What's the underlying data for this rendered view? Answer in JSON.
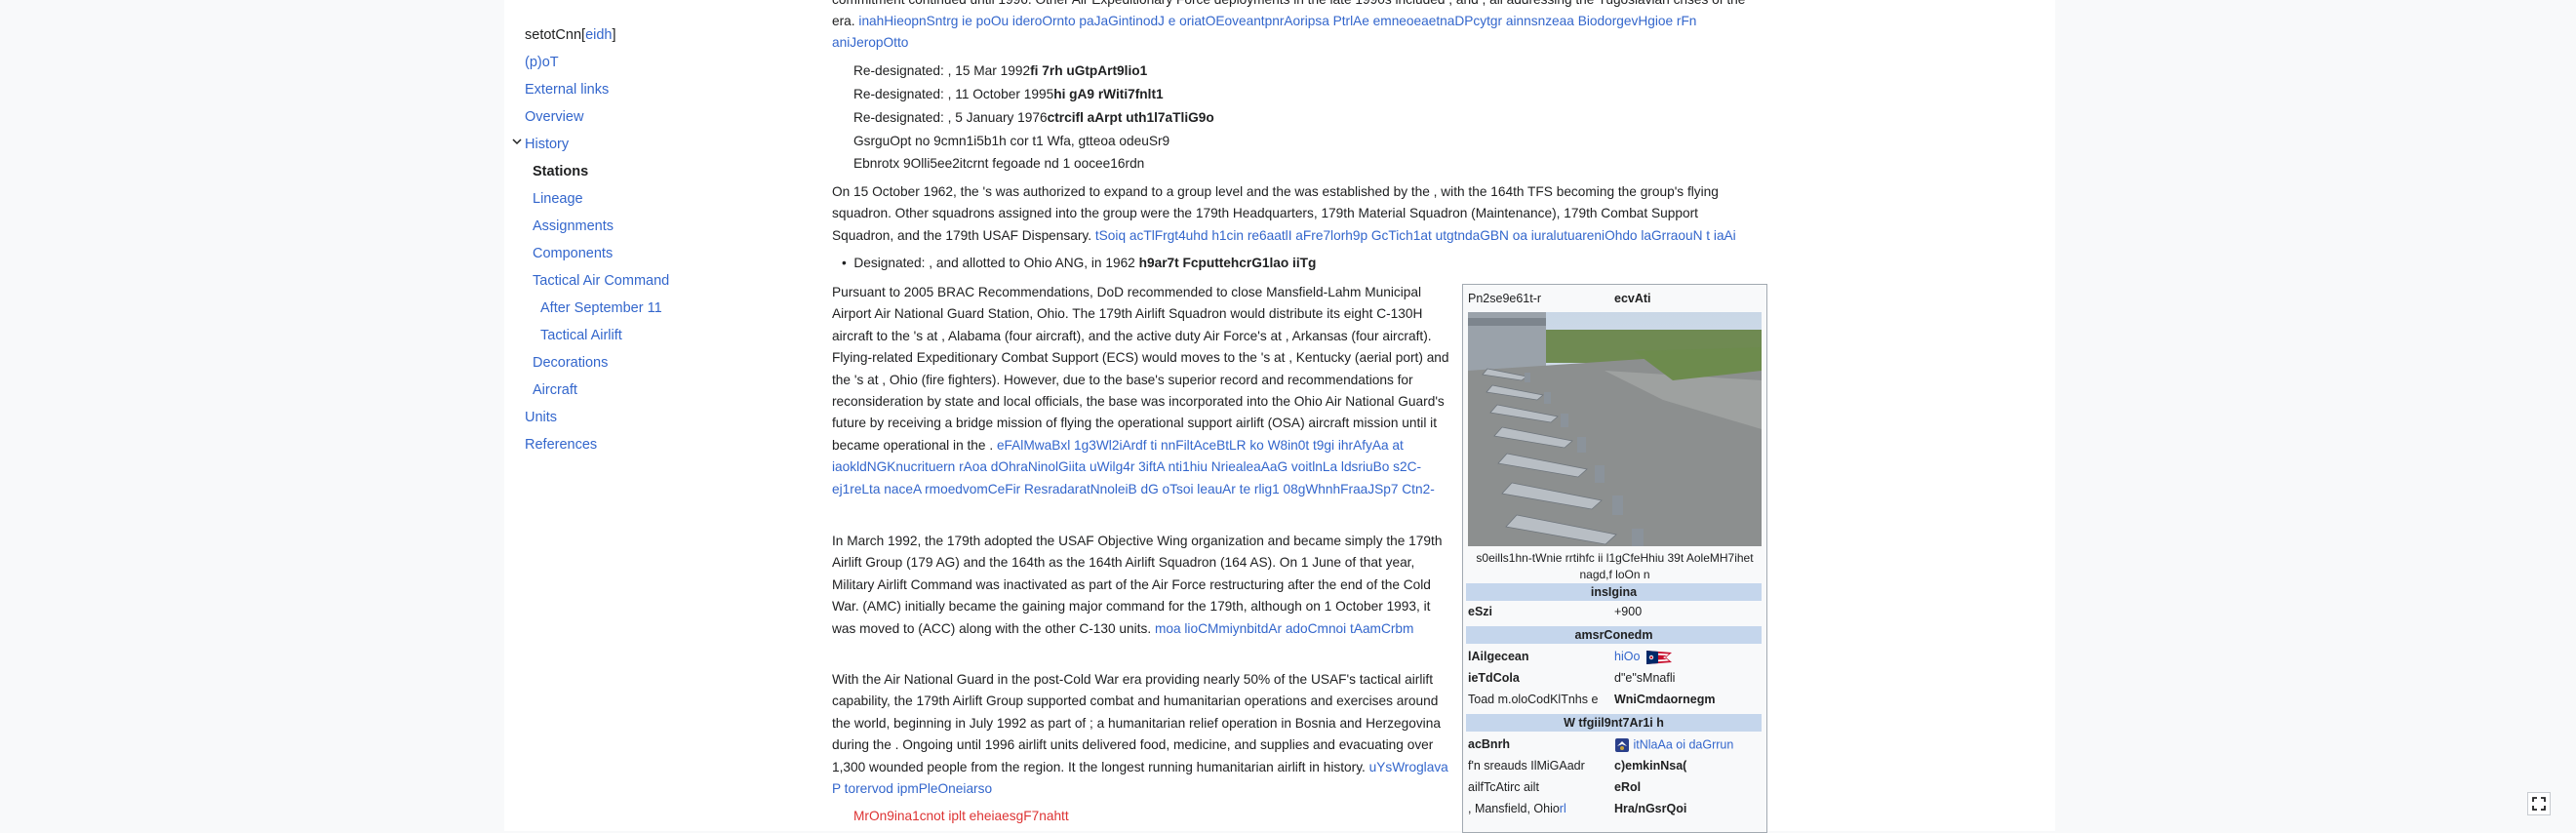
{
  "toc": {
    "contents_label": "setotCnn",
    "hide_label": "eidh",
    "items": [
      {
        "label": "(p)oT"
      },
      {
        "label": "External links"
      },
      {
        "label": "Overview"
      },
      {
        "label": "History"
      },
      {
        "label": "Stations"
      },
      {
        "label": "Lineage"
      },
      {
        "label": "Assignments"
      },
      {
        "label": "Components"
      },
      {
        "label": "Tactical Air Command"
      },
      {
        "label": "After September 11"
      },
      {
        "label": "Tactical Airlift"
      },
      {
        "label": "Decorations"
      },
      {
        "label": "Aircraft"
      },
      {
        "label": "Units"
      },
      {
        "label": "References"
      }
    ]
  },
  "article": {
    "top_text_1": "commitment continued until 1996. Other Air Expeditionary Force deployments in the late 1990s included , and , all addressing the Yugoslavian crises of the",
    "top_text_2_a": "era.",
    "top_text_2_link": "inahHieopnSntrg ie poOu ideroOrnto paJaGintinodJ e oriatOEoveantpnrAoripsa PtrlAe emneoeaetnaDPcytgr ainnsnzeaa BiodorgevHgioe rFn",
    "top_text_3_link": "aniJeropOtto",
    "redesig_1": {
      "text": "Re-designated: , 15 Mar 1992",
      "bold": "fi 7rh uGtpArt9lio1"
    },
    "redesig_2": {
      "text": "Re-designated: , 11 October 1995",
      "bold": "hi gA9 rWiti7fnlt1"
    },
    "redesig_3": {
      "text": "Re-designated: , 5 January 1976",
      "bold": "ctrcifl aArpt uth1l7aTliG9o"
    },
    "line_4": "GsrguOpt no 9cmn1i5b1h cor t1 Wfa, gtteoa odeuSr9",
    "line_5": "Ebnrotx 9Olli5ee2itcrnt fegoade nd 1 oocee16rdn",
    "para_1962": "On 15 October 1962, the 's was authorized to expand to a group level and the was established by the , with the 164th TFS becoming the group's flying squadron. Other squadrons assigned into the group were the 179th Headquarters, 179th Material Squadron (Maintenance), 179th Combat Support Squadron, and the 179th USAF Dispensary.",
    "para_1962_link": "tSoiq acTlFrgt4uhd h1cin re6aatlI aFre7lorh9p GcTich1at utgtndaGBN oa iuralutuareniOhdo laGrraouN t iaAi",
    "bullet_text": "Designated: , and allotted to Ohio ANG, in 1962",
    "bullet_bold": "h9ar7t FcputtehcrG1lao iiTg",
    "brac_para": "Pursuant to 2005 BRAC Recommendations, DoD recommended to close Mansfield-Lahm Municipal Airport Air National Guard Station, Ohio. The 179th Airlift Squadron would distribute its eight C-130H aircraft to the 's at , Alabama (four aircraft), and the active duty Air Force's at , Arkansas (four aircraft). Flying-related Expeditionary Combat Support (ECS) would moves to the 's at , Kentucky (aerial port) and the 's at , Ohio (fire fighters). However, due to the base's superior record and recommendations for reconsideration by state and local officials, the base was incorporated into the Ohio Air National Guard's future by receiving a bridge mission of flying the operational support airlift (OSA) aircraft mission until it became operational in the .",
    "brac_link": "eFAlMwaBxl 1g3Wl2iArdf ti nnFiltAceBtLR ko W8in0t t9gi ihrAfyAa at iaokldNGKnucrituern rAoa dOhraNinolGiita uWilg4r 3iftA nti1hiu NriealeaAaG voitlnLa ldsriuBo s2C-ej1reLta naceA rmoedvomCeFir ResradaratNnoleiB dG oTsoi leauAr te rlig1 08gWhnhFraaJSp7 Ctn2-",
    "march_para": "In March 1992, the 179th adopted the USAF Objective Wing organization and became simply the 179th Airlift Group (179 AG) and the 164th as the 164th Airlift Squadron (164 AS). On 1 June of that year, Military Airlift Command was inactivated as part of the Air Force restructuring after the end of the Cold War. (AMC) initially became the gaining major command for the 179th, although on 1 October 1993, it was moved to (ACC) along with the other C-130 units.",
    "march_link": "moa lioCMmiynbitdAr adoCmnoi tAamCrbm",
    "ang_para": "With the Air National Guard in the post-Cold War era providing nearly 50% of the USAF's tactical airlift capability, the 179th Airlift Group supported combat and humanitarian operations and exercises around the world, beginning in July 1992 as part of ; a humanitarian relief operation in Bosnia and Herzegovina during the . Ongoing until 1996 airlift units delivered food, medicine, and supplies and evacuating over 1,300 wounded people from the region. It the longest running humanitarian airlift in history.",
    "ang_link": "uYsWroglava P torervod ipmPleOneiarso",
    "red_link": "MrOn9ina1cnot iplt eheiaesgF7nahtt"
  },
  "infobox": {
    "row_top": {
      "k": "Pn2se9e61t-r",
      "v": "ecvAti"
    },
    "caption": "s0eills1hn-tWnie rrtihfc ii l1gCfeHhiu 39t AoleMH7ihet nagd,f loOn n",
    "insignia_header": "insIgina",
    "insignia": {
      "k": "eSzi",
      "v": "+900"
    },
    "command_header": "amsrConedm",
    "rows_cmd": [
      {
        "k": "lAilgecean",
        "v": "hiOo"
      },
      {
        "k": "ieTdCola",
        "v": "d\"e\"sMnafli"
      },
      {
        "k": "Toad m.oloCodKlTnhs e",
        "v": "WniCmdaornegm"
      }
    ],
    "flying_header": "W tfgiil9nt7Ar1i h",
    "rows_fly": [
      {
        "k": "acBnrh",
        "v": "itNlaAa oi daGrrun"
      },
      {
        "k": "f'n sreauds IlMiGAadr",
        "v": "c)emkinNsa("
      },
      {
        "k": "ailfTcAtirc ailt",
        "v": "eRol"
      },
      {
        "k": ", Mansfield, Ohio",
        "v": "Hra/nGsrQoi"
      }
    ],
    "mansfield_link": "rl"
  },
  "colors": {
    "link": "#3366cc",
    "redlink": "#d33",
    "header_bg": "#c5d6ec"
  }
}
